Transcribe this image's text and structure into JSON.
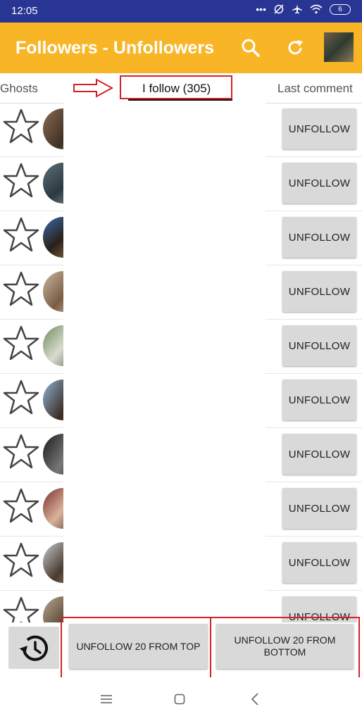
{
  "status": {
    "time": "12:05",
    "battery": "6"
  },
  "appbar": {
    "title": "Followers - Unfollowers"
  },
  "tabs": [
    {
      "label": "Ghosts"
    },
    {
      "label": "I follow (305)"
    },
    {
      "label": "Last comment"
    }
  ],
  "rows": [
    {
      "button": "UNFOLLOW"
    },
    {
      "button": "UNFOLLOW"
    },
    {
      "button": "UNFOLLOW"
    },
    {
      "button": "UNFOLLOW"
    },
    {
      "button": "UNFOLLOW"
    },
    {
      "button": "UNFOLLOW"
    },
    {
      "button": "UNFOLLOW"
    },
    {
      "button": "UNFOLLOW"
    },
    {
      "button": "UNFOLLOW"
    },
    {
      "button": "UNFOLLOW"
    }
  ],
  "bottom": {
    "top_button": "UNFOLLOW 20 FROM TOP",
    "bottom_button": "UNFOLLOW 20 FROM BOTTOM"
  },
  "colors": {
    "statusbar": "#283593",
    "appbar": "#f8b627",
    "annotation": "#d6202a",
    "button": "#d9d9d9"
  }
}
